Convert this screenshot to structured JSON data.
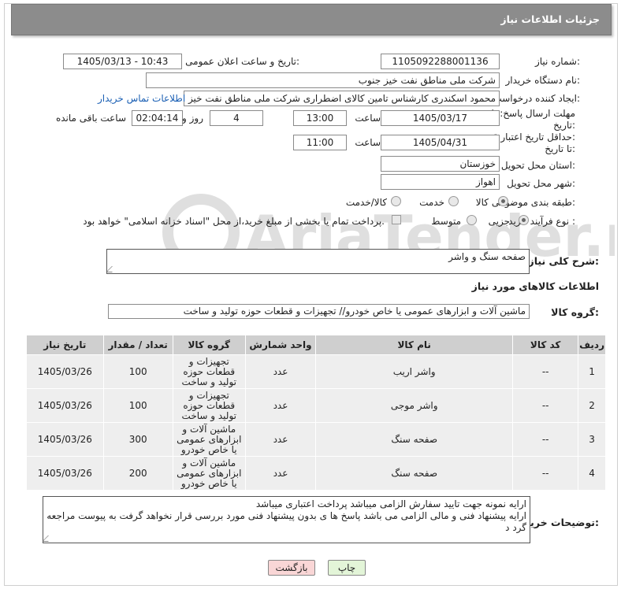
{
  "header": {
    "title": "جزئیات اطلاعات نیاز"
  },
  "fields": {
    "need_number_label": "شماره نیاز:",
    "need_number": "1105092288001136",
    "announce_label": "تاریخ و ساعت اعلان عمومی:",
    "announce_value": "1405/03/13 - 10:43",
    "buyer_label": "نام دستگاه خریدار:",
    "buyer_value": "شرکت ملی مناطق نفت خیز جنوب",
    "creator_label": "ایجاد کننده درخواست:",
    "creator_value": "محمود  اسکندری کارشناس تامین کالای اضطراری شرکت ملی مناطق نفت خیز",
    "contact_link": "اطلاعات تماس خریدار",
    "deadline_label_1": "مهلت ارسال پاسخ: تا",
    "deadline_label_2": "تاریخ:",
    "deadline_date": "1405/03/17",
    "time_label": "ساعت",
    "deadline_time": "13:00",
    "days_value": "4",
    "days_label": "روز و",
    "remaining_time": "02:04:14",
    "remaining_label": "ساعت باقی مانده",
    "validity_label_1": "حداقل تاریخ اعتبار قیمت:",
    "validity_label_2": "تا تاریخ:",
    "validity_date": "1405/04/31",
    "validity_time": "11:00",
    "province_label": "استان محل تحویل:",
    "province_value": "خوزستان",
    "city_label": "شهر محل تحویل:",
    "city_value": "اهواز",
    "category_label": "طبقه بندی موضوعی:",
    "category_options": [
      "کالا",
      "خدمت",
      "کالا/خدمت"
    ],
    "process_label": "نوع فرآیند خرید :",
    "process_options": [
      "جزیی",
      "متوسط"
    ],
    "payment_note": "پرداخت تمام یا بخشی از مبلغ خرید،از محل \"اسناد خزانه اسلامی\" خواهد بود."
  },
  "description": {
    "label": "شرح کلی نیاز:",
    "value": "صفحه سنگ و واشر"
  },
  "goods_info_title": "اطلاعات کالاهای مورد نیاز",
  "goods_group": {
    "label": "گروه کالا:",
    "value": "ماشین آلات و ابزارهای عمومی یا خاص خودرو// تجهیزات و قطعات حوزه تولید و ساخت"
  },
  "table": {
    "headers": [
      "ردیف",
      "کد کالا",
      "نام کالا",
      "واحد شمارش",
      "گروه کالا",
      "تعداد / مقدار",
      "تاریخ نیاز"
    ],
    "rows": [
      [
        "1",
        "--",
        "واشر اریب",
        "عدد",
        "تجهیزات و قطعات حوزه تولید و ساخت",
        "100",
        "1405/03/26"
      ],
      [
        "2",
        "--",
        "واشر موجی",
        "عدد",
        "تجهیزات و قطعات حوزه تولید و ساخت",
        "100",
        "1405/03/26"
      ],
      [
        "3",
        "--",
        "صفحه سنگ",
        "عدد",
        "ماشین آلات و ابزارهای عمومی یا خاص خودرو",
        "300",
        "1405/03/26"
      ],
      [
        "4",
        "--",
        "صفحه سنگ",
        "عدد",
        "ماشین آلات و ابزارهای عمومی یا خاص خودرو",
        "200",
        "1405/03/26"
      ]
    ]
  },
  "buyer_notes": {
    "label": "توضیحات خریدار:",
    "line1": "ارایه نمونه جهت تایید سفارش الزامی میباشد پرداخت اعتباری میباشد",
    "line2": "ارایه پیشنهاد فنی و مالی الزامی می باشد پاسخ ها ی بدون پیشنهاد فنی مورد بررسی قرار نخواهد گرفت به پیوست مراجعه گرد د"
  },
  "buttons": {
    "print": "چاپ",
    "back": "بازگشت"
  },
  "colors": {
    "header_bg": "#8c8c8c",
    "back_btn_bg": "#f9d6d6",
    "print_btn_bg": "#e3f5d8"
  }
}
